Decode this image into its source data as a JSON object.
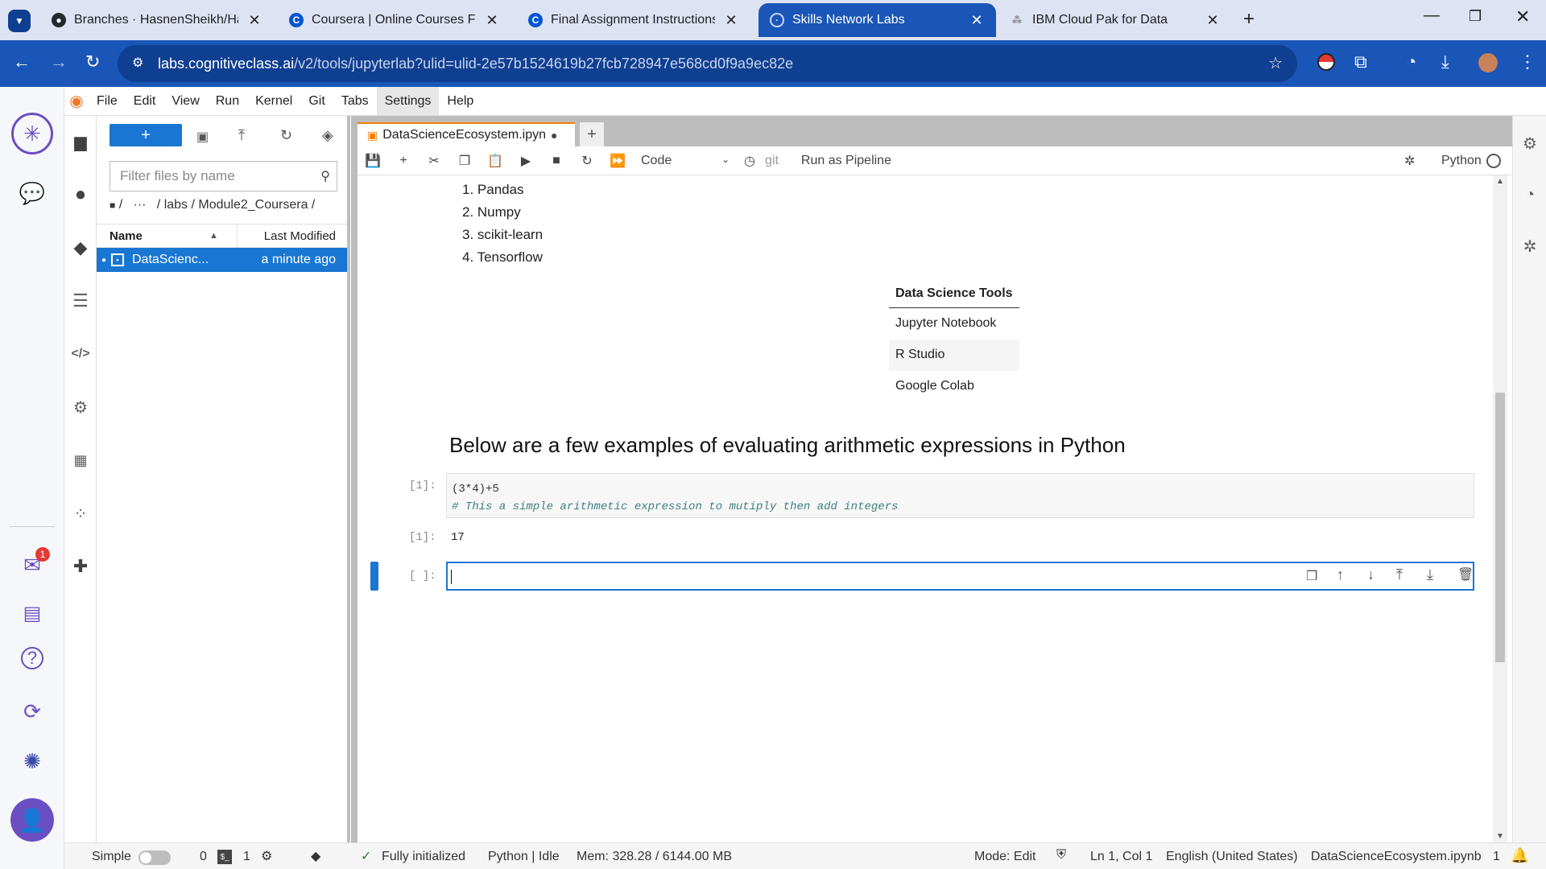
{
  "tabs": [
    {
      "title": "Branches · HasnenSheikh/Hasne",
      "icon": "github-icon"
    },
    {
      "title": "Coursera | Online Courses From",
      "icon": "coursera-icon"
    },
    {
      "title": "Final Assignment Instructions: C",
      "icon": "coursera-icon"
    },
    {
      "title": "Skills Network Labs",
      "icon": "skills-network-icon"
    },
    {
      "title": "IBM Cloud Pak for Data",
      "icon": "ibm-icon"
    }
  ],
  "url": {
    "host": "labs.cognitiveclass.ai",
    "path": "/v2/tools/jupyterlab?ulid=ulid-2e57b1524619b27fcb728947e568cd0f9a9ec82e"
  },
  "menu": [
    "File",
    "Edit",
    "View",
    "Run",
    "Kernel",
    "Git",
    "Tabs",
    "Settings",
    "Help"
  ],
  "skills_badge": "1",
  "filebrowser": {
    "new_label": "+",
    "filter_placeholder": "Filter files by name",
    "crumbs": "/   ···   / labs / Module2_Coursera /",
    "col_name": "Name",
    "col_modified": "Last Modified",
    "file_name": "DataScienc...",
    "file_modified": "a minute ago"
  },
  "notebook": {
    "tab_title": "DataScienceEcosystem.ipyn",
    "cell_type": "Code",
    "git_label": "git",
    "pipeline_label": "Run as Pipeline",
    "kernel": "Python",
    "list_items": [
      "1. Pandas",
      "2. Numpy",
      "3. scikit-learn",
      "4. Tensorflow"
    ],
    "table_header": "Data Science Tools",
    "table_rows": [
      "Jupyter Notebook",
      "R Studio",
      "Google Colab"
    ],
    "heading": "Below are a few examples of evaluating arithmetic expressions in Python",
    "code_prompt": "[1]:",
    "code_line1": "(3*4)+5",
    "code_line2": "# This a simple arithmetic expression to mutiply then add integers",
    "output_prompt": "[1]:",
    "output": "17",
    "empty_prompt": "[ ]:"
  },
  "status": {
    "mode_simple": "Simple",
    "terminals": "0",
    "kernels": "1",
    "initialized": "Fully initialized",
    "kernel_state": "Python | Idle",
    "mem": "Mem: 328.28 / 6144.00 MB",
    "edit_mode": "Mode: Edit",
    "position": "Ln 1, Col 1",
    "language": "English (United States)",
    "filename": "DataScienceEcosystem.ipynb",
    "notifications": "1"
  },
  "colors": {
    "accent": "#1976d2",
    "chrome": "#1a56b8"
  }
}
